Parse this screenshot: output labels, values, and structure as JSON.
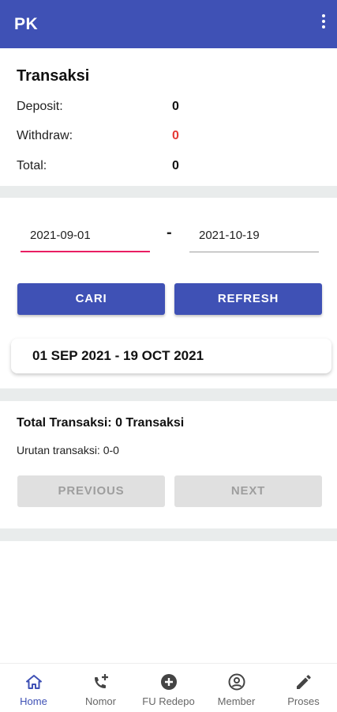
{
  "appbar": {
    "title": "PK",
    "menu_icon": "more-vert-icon"
  },
  "summary": {
    "title": "Transaksi",
    "rows": [
      {
        "label": "Deposit:",
        "value": "0"
      },
      {
        "label": "Withdraw:",
        "value": "0"
      },
      {
        "label": "Total:",
        "value": "0"
      }
    ]
  },
  "filter": {
    "date_from": "2021-09-01",
    "separator": "-",
    "date_to": "2021-10-19",
    "search_label": "CARI",
    "refresh_label": "REFRESH",
    "range_text": "01 SEP 2021 - 19 OCT 2021"
  },
  "results": {
    "total_text": "Total Transaksi: 0 Transaksi",
    "order_text": "Urutan transaksi: 0-0",
    "previous_label": "PREVIOUS",
    "next_label": "NEXT"
  },
  "bottom_nav": [
    {
      "label": "Home",
      "icon": "home-icon",
      "active": true
    },
    {
      "label": "Nomor",
      "icon": "phone-add-icon",
      "active": false
    },
    {
      "label": "FU Redepo",
      "icon": "add-circle-icon",
      "active": false
    },
    {
      "label": "Member",
      "icon": "account-circle-icon",
      "active": false
    },
    {
      "label": "Proses",
      "icon": "edit-pencil-icon",
      "active": false
    }
  ],
  "colors": {
    "primary": "#3f51b5",
    "withdraw_value": "#e53935",
    "date_from_underline": "#e91e63",
    "disabled_button": "#e0e0e0"
  }
}
